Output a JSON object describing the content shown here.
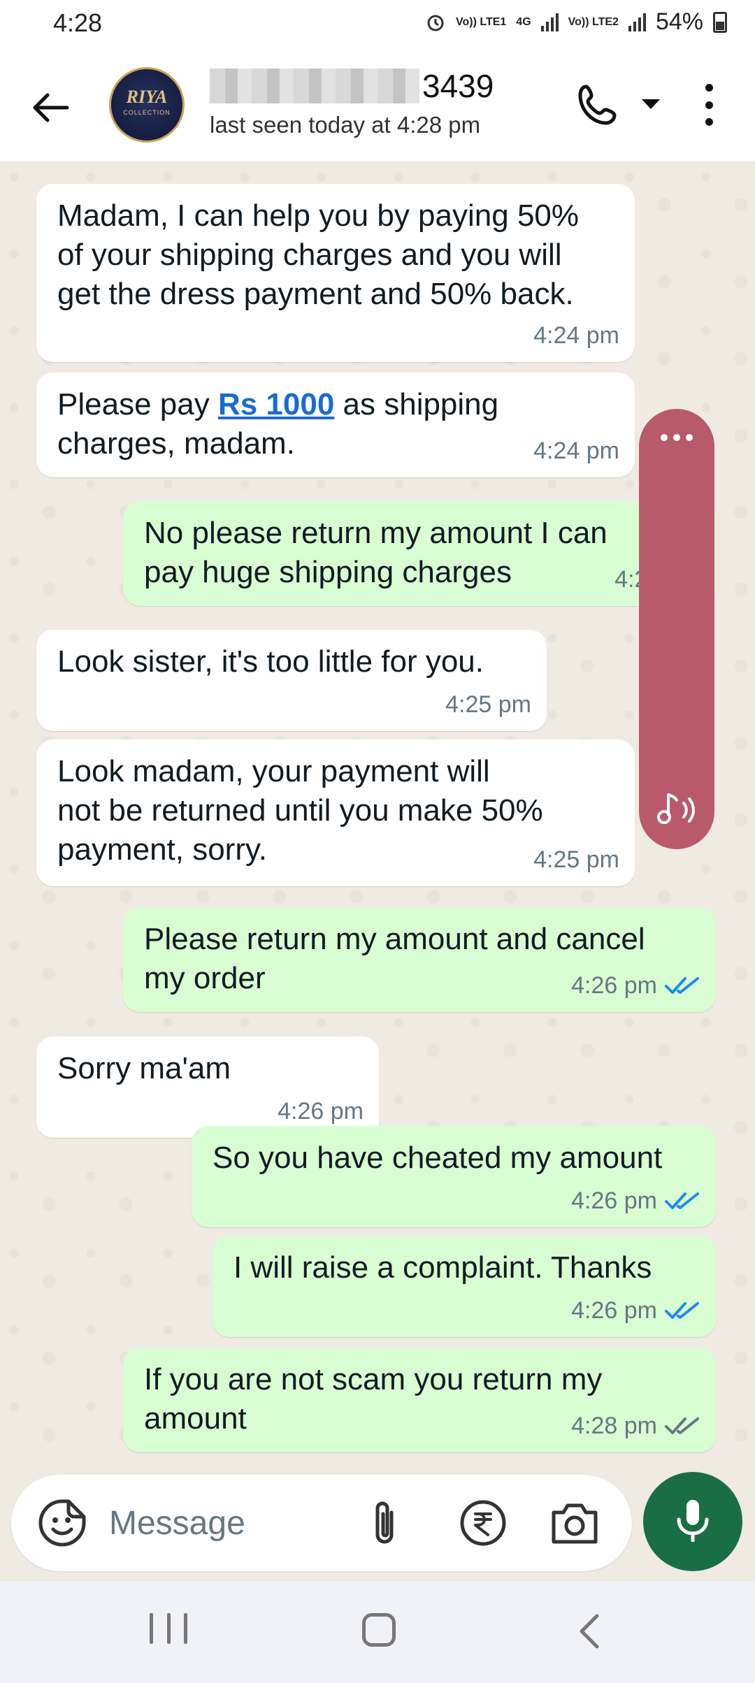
{
  "status_bar": {
    "time": "4:28",
    "net1": "Vo)) LTE1",
    "net_4g": "4G",
    "net2": "Vo)) LTE2",
    "battery": "54%"
  },
  "header": {
    "contact_name_suffix": "3439",
    "last_seen": "last seen today at 4:28 pm",
    "avatar_text": "RIYA",
    "avatar_subtext": "COLLECTION"
  },
  "messages": [
    {
      "direction": "in",
      "text": "Madam, I can help you by paying 50%\nof your shipping charges and you will\nget the dress payment and 50% back.",
      "time": "4:24 pm"
    },
    {
      "direction": "in",
      "text_before": "Please pay ",
      "link": "Rs 1000",
      "text_after": " as shipping\ncharges, madam.",
      "time": "4:24 pm"
    },
    {
      "direction": "out",
      "text": "No please return my amount I can\npay huge shipping charges",
      "time": "4:25 pm"
    },
    {
      "direction": "in",
      "text": "Look sister, it's too little for you.",
      "time": "4:25 pm"
    },
    {
      "direction": "in",
      "text": "Look madam, your payment will\nnot be returned until you make 50%\npayment, sorry.",
      "time": "4:25 pm"
    },
    {
      "direction": "out",
      "text": "Please return my amount and cancel\nmy order",
      "time": "4:26 pm",
      "status": "read"
    },
    {
      "direction": "in",
      "text": "Sorry ma'am",
      "time": "4:26 pm"
    },
    {
      "direction": "out",
      "text": "So you have cheated my amount",
      "time": "4:26 pm",
      "status": "read"
    },
    {
      "direction": "out",
      "text": "I will raise a complaint. Thanks",
      "time": "4:26 pm",
      "status": "read"
    },
    {
      "direction": "out",
      "text": "If you are not scam you return my\namount",
      "time": "4:28 pm",
      "status": "delivered"
    }
  ],
  "input": {
    "placeholder": "Message"
  },
  "icons": {
    "back": "arrow-left-icon",
    "call": "phone-icon",
    "dropdown": "caret-down-icon",
    "menu": "more-vert-icon",
    "emoji": "sticker-icon",
    "attach": "paperclip-icon",
    "rupee": "rupee-icon",
    "camera": "camera-icon",
    "mic": "microphone-icon",
    "read_tick": "double-check-blue-icon",
    "delivered_tick": "double-check-gray-icon"
  },
  "colors": {
    "incoming_bubble": "#ffffff",
    "outgoing_bubble": "#d9fdd3",
    "chat_background": "#efeae2",
    "read_tick": "#1f8cea",
    "delivered_tick": "#667781",
    "mic_button": "#1a6e43",
    "link": "#1a6bd1",
    "floating_pill": "#b95a6b"
  }
}
